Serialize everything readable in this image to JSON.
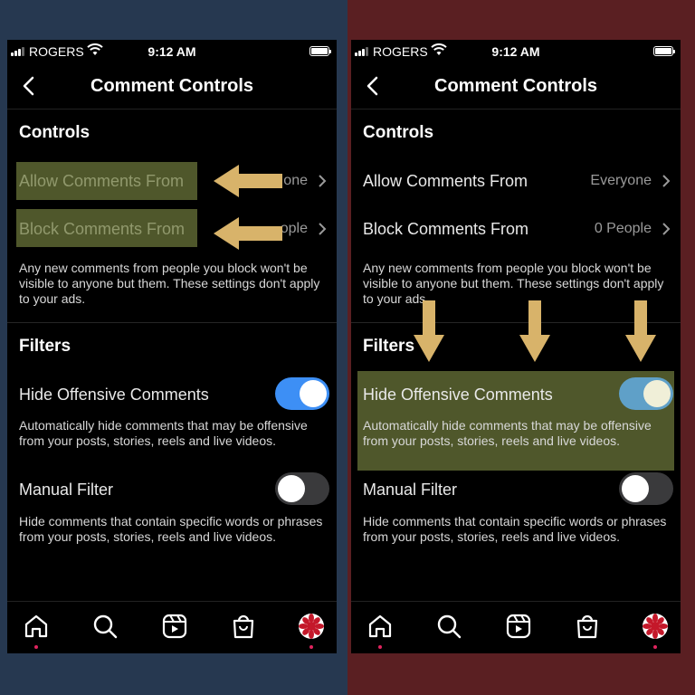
{
  "status": {
    "carrier": "ROGERS",
    "time": "9:12 AM"
  },
  "nav": {
    "title": "Comment Controls"
  },
  "controls": {
    "heading": "Controls",
    "allow_label": "Allow Comments From",
    "allow_value": "Everyone",
    "allow_value_partial": "one",
    "block_label": "Block Comments From",
    "block_value": "0 People",
    "block_value_partial": "ople",
    "description": "Any new comments from people you block won't be visible to anyone but them. These settings don't apply to your ads."
  },
  "filters": {
    "heading": "Filters",
    "hide_offensive_label": "Hide Offensive Comments",
    "hide_offensive_desc": "Automatically hide comments that may be offensive from your posts, stories, reels and live videos.",
    "manual_label": "Manual Filter",
    "manual_desc": "Hide comments that contain specific words or phrases from your posts, stories, reels and live videos."
  },
  "toggles": {
    "hide_offensive": true,
    "manual_filter": false
  },
  "tabs": [
    "home-icon",
    "search-icon",
    "reels-icon",
    "shop-icon",
    "profile-avatar"
  ],
  "colors": {
    "bg_left": "#263850",
    "bg_right": "#5a1f22",
    "toggle_on_left": "#3d8ff5",
    "toggle_on_right": "#5fa0c8",
    "toggle_off": "#3a3a3c",
    "highlight": "#6e783c",
    "arrow": "#d8b36a",
    "accent_dot": "#e0245e"
  }
}
